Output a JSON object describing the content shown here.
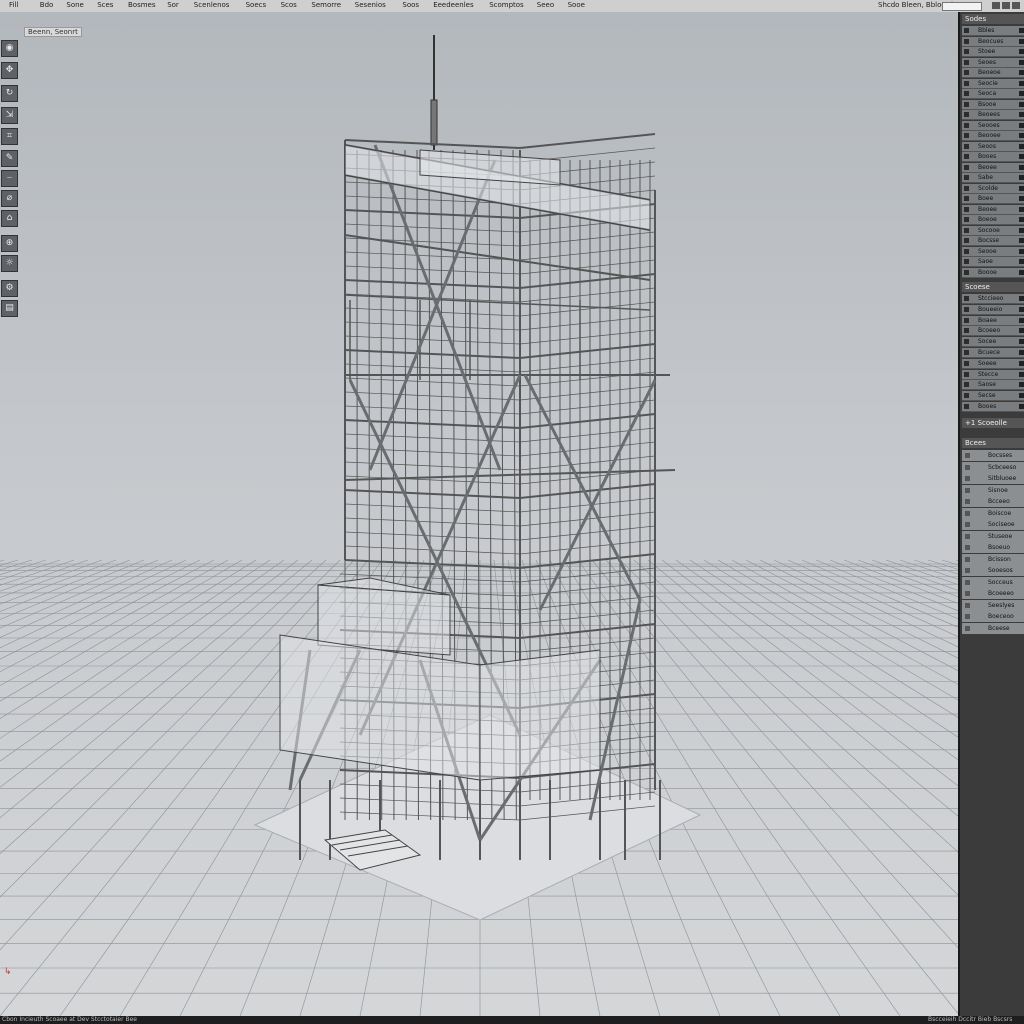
{
  "menubar": {
    "items": [
      "Fill",
      "Bdo",
      "Sone",
      "Sces",
      "Bosmes",
      "Sor",
      "Scenlenos",
      "Soecs",
      "Scos",
      "Semorre",
      "Sesenios",
      "Soos",
      "Eeedeenles",
      "Scomptos",
      "Seeo",
      "Sooe"
    ],
    "status": "Shcdo Bleen, Bbloerd"
  },
  "viewport": {
    "label": "Beenn, Seonrt"
  },
  "panel": {
    "header": "Sodes",
    "items": [
      "Bbles",
      "Beocues",
      "Stoee",
      "Seoes",
      "Beoeoe",
      "Seocie",
      "Seoca",
      "Bsooe",
      "Beoees",
      "Seooes",
      "Beooee",
      "Seoos",
      "Booes",
      "Beoee",
      "Sabe",
      "Scolde",
      "Boee",
      "Beoee",
      "Boeoe",
      "Socooe",
      "Bocsse",
      "Seooe",
      "Saoe",
      "Boooe"
    ],
    "section2_header": "Scoese",
    "items2": [
      "Stccieeo",
      "Boueeio",
      "Boaee",
      "Bcoeeo",
      "Socee",
      "Bcuece",
      "Soeee",
      "Stecce",
      "Saose",
      "Secse",
      "Booes"
    ],
    "section3_header": "+1 Scoeolle",
    "section3_header2": "Bcees",
    "props": [
      "Bocsses",
      "Scbceeso",
      "Sitbluoee",
      "Sisnoe",
      "Bcceeo",
      "Boiscoe",
      "Sociseoe",
      "Stuseoe",
      "Bsoeuo",
      "Bcisson",
      "Sooesos",
      "Socceus",
      "Bcoeeeo",
      "Seeslyes",
      "Boeceoo",
      "Bceese"
    ]
  },
  "statusbar": {
    "left": "Cbon Incieuth Scoaee at Dev Stcctotaier Bee",
    "right": "Bscceieih Dccitr Bieb Bscsrs"
  }
}
